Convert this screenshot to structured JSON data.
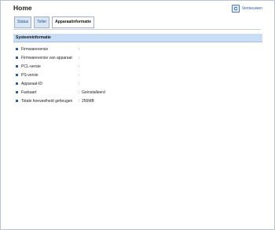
{
  "page": {
    "title": "Home"
  },
  "header": {
    "refresh_label": "Vernieuwen",
    "refresh_icon": "refresh-icon"
  },
  "tabs": [
    {
      "label": "Status",
      "active": false
    },
    {
      "label": "Teller",
      "active": false
    },
    {
      "label": "Apparaatinformatie",
      "active": true
    }
  ],
  "section": {
    "title": "Systeeminformatie",
    "rows": [
      {
        "label": "Firmwareversie",
        "value": ""
      },
      {
        "label": "Firmwareversie van apparaat",
        "value": ""
      },
      {
        "label": "PCL-versie",
        "value": ""
      },
      {
        "label": "PS-versie",
        "value": ""
      },
      {
        "label": "Apparaat-ID",
        "value": ""
      },
      {
        "label": "Faxkaart",
        "value": "Geïnstalleerd"
      },
      {
        "label": "Totale hoeveelheid geheugen",
        "value": "256MB"
      }
    ]
  },
  "colors": {
    "accent": "#315a9a",
    "section_header_bg": "#c9ddf6",
    "tab_bg": "#dbe6f4"
  }
}
